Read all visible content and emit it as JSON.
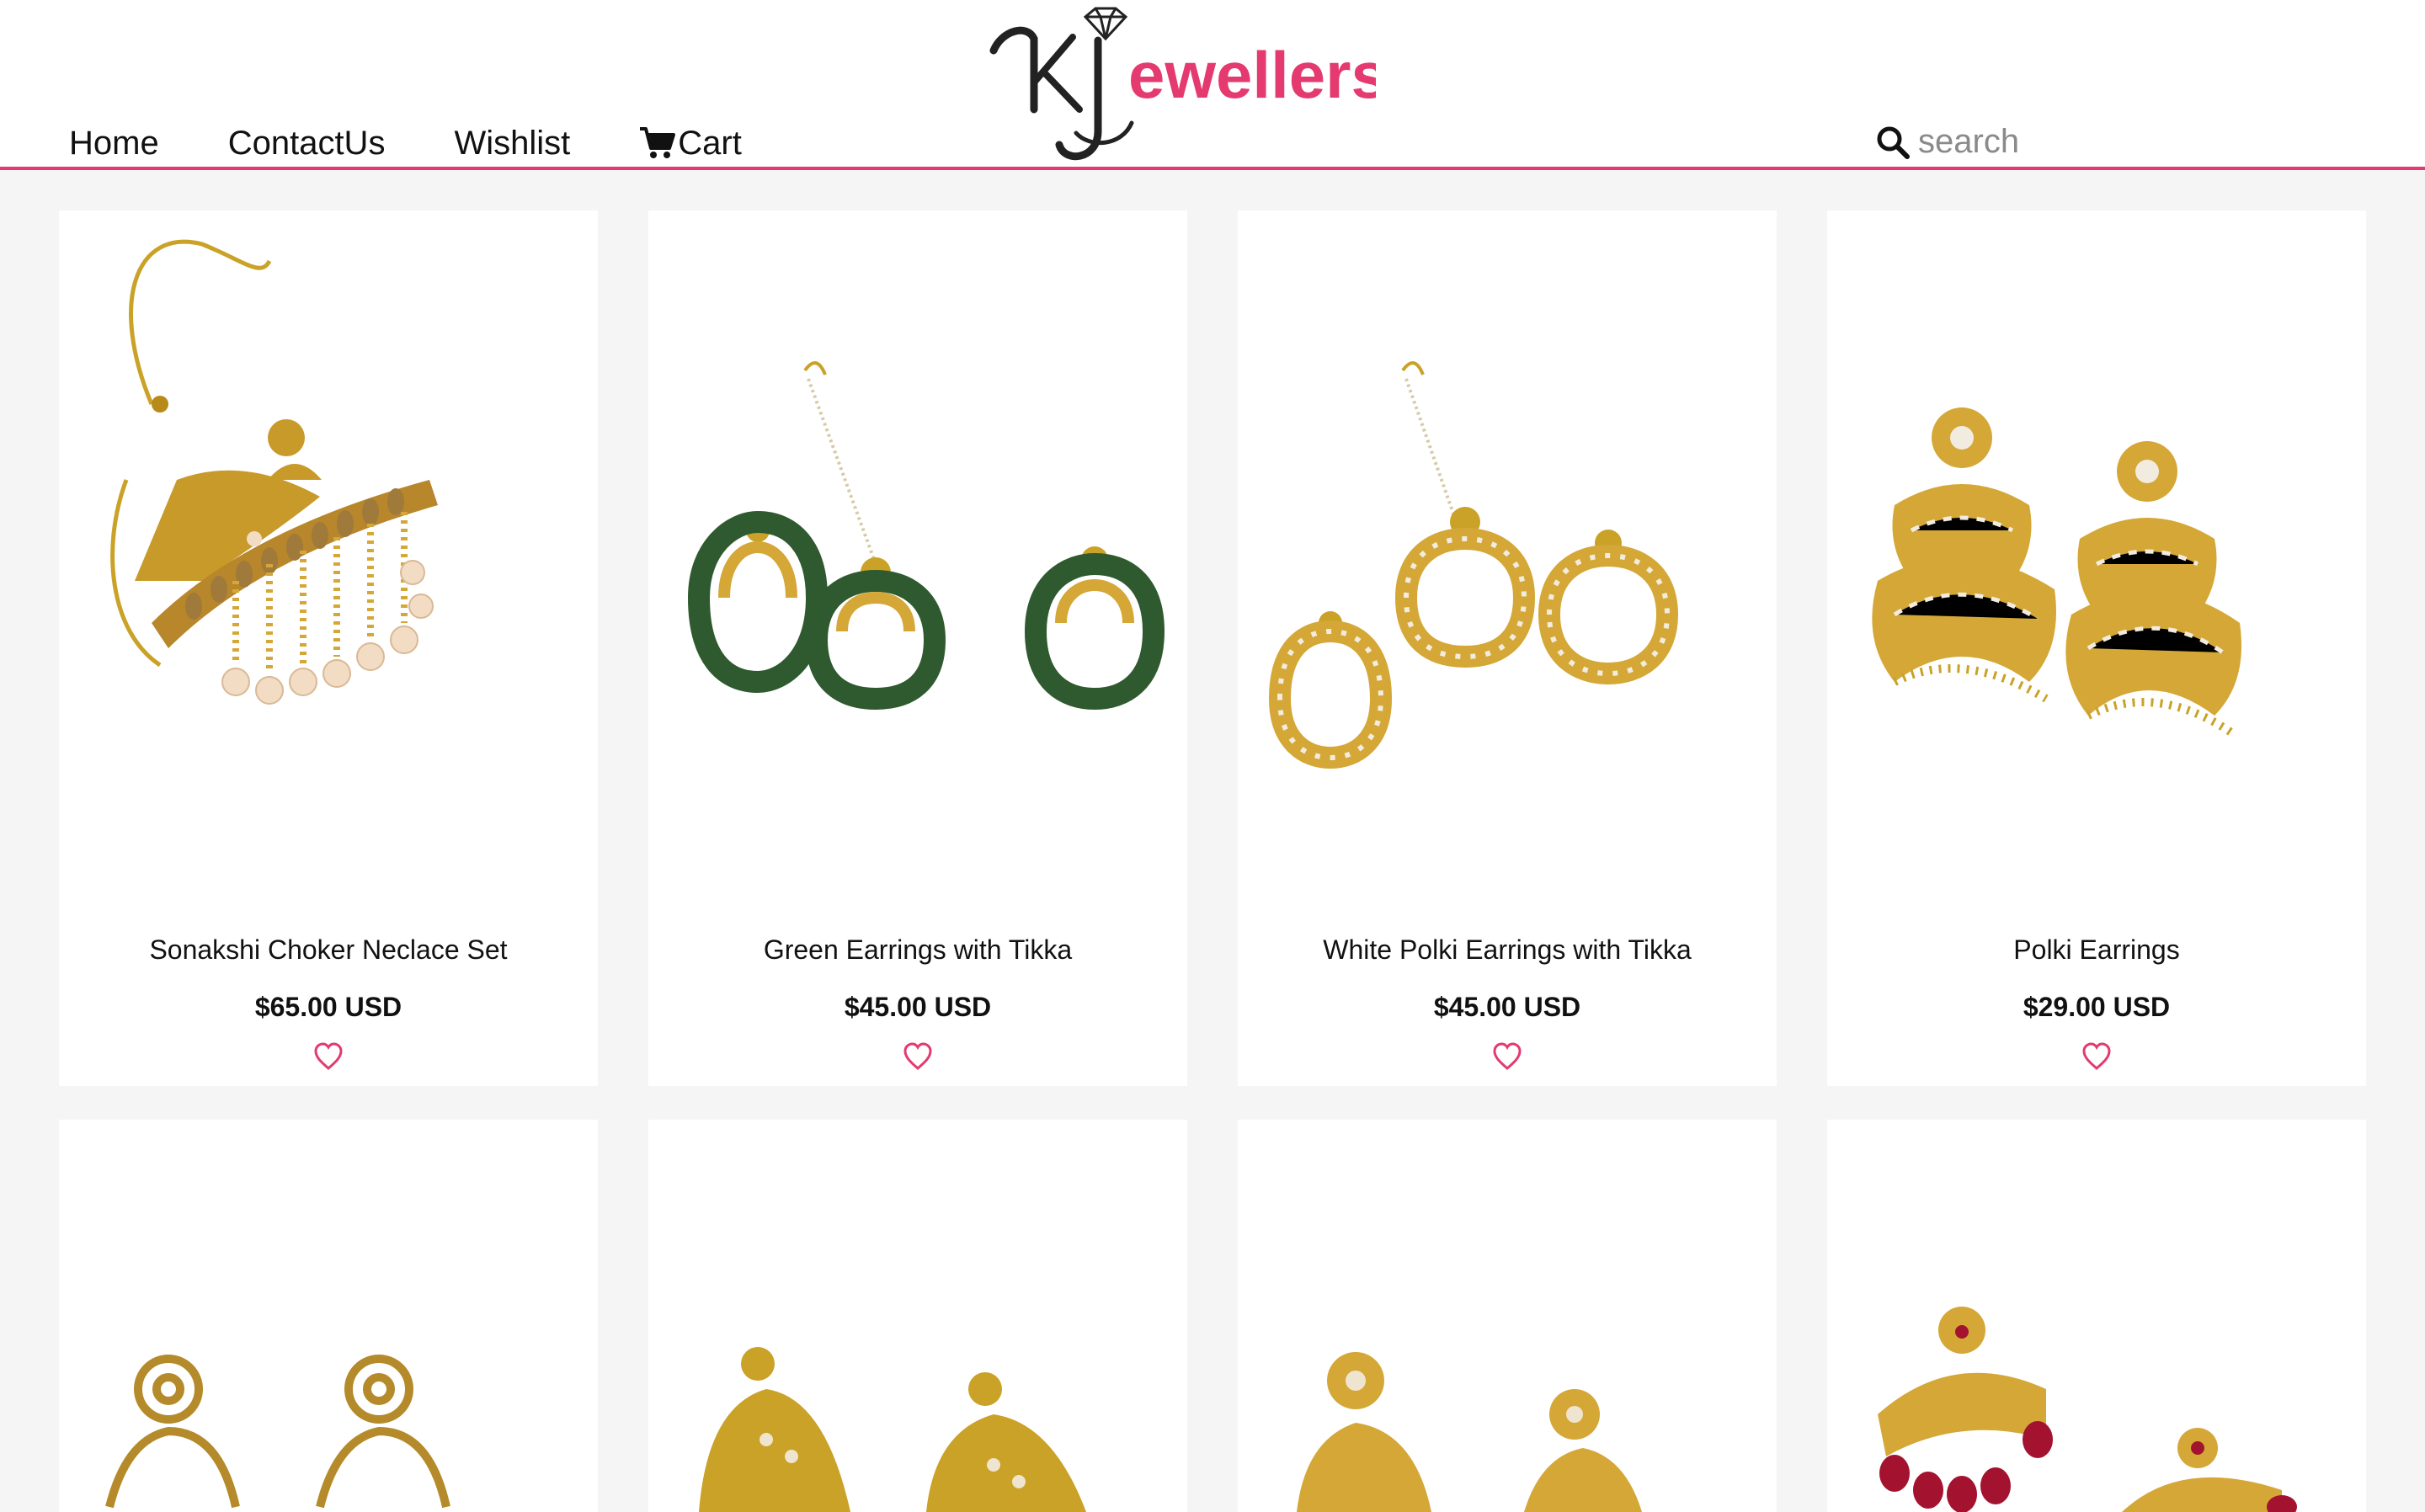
{
  "header": {
    "logo_text": "ewellers",
    "nav": [
      {
        "label": "Home"
      },
      {
        "label": "ContactUs"
      },
      {
        "label": "Wishlist"
      },
      {
        "label": "Cart",
        "icon": "cart-icon"
      }
    ],
    "search": {
      "placeholder": "search",
      "icon": "search-icon"
    }
  },
  "colors": {
    "accent": "#e43a6f",
    "page_bg": "#f5f5f5",
    "card_bg": "#ffffff",
    "gold": "#d4a017"
  },
  "products": [
    {
      "name": "Sonakshi Choker Neclace Set",
      "price": "$65.00 USD",
      "image": "choker-necklace-set"
    },
    {
      "name": "Green Earrings with Tikka",
      "price": "$45.00 USD",
      "image": "green-earrings-tikka"
    },
    {
      "name": "White Polki Earrings with Tikka",
      "price": "$45.00 USD",
      "image": "white-polki-earrings-tikka"
    },
    {
      "name": "Polki Earrings",
      "price": "$29.00 USD",
      "image": "polki-earrings"
    },
    {
      "name": "",
      "price": "",
      "image": "antique-earrings"
    },
    {
      "name": "",
      "price": "",
      "image": "gold-jhumka-earrings"
    },
    {
      "name": "",
      "price": "",
      "image": "kundan-earrings"
    },
    {
      "name": "",
      "price": "",
      "image": "red-bead-earrings"
    }
  ]
}
